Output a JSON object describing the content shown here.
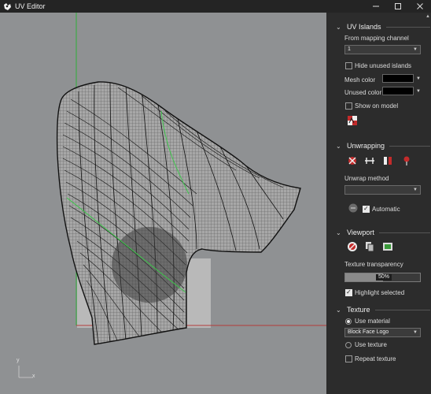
{
  "window": {
    "title": "UV Editor"
  },
  "titlebar": {
    "icons": [
      "app-logo-icon",
      "minimize-icon",
      "maximize-icon",
      "close-icon"
    ]
  },
  "viewport": {
    "axis_y_label": "y",
    "axis_x_label": "x",
    "colors": {
      "background": "#8f9193",
      "x_axis": "#b33a3a",
      "y_axis": "#2fae3a",
      "mesh": "#111111",
      "seam": "#3cc84a"
    }
  },
  "panel": {
    "uv_islands": {
      "header": "UV Islands",
      "from_mapping_channel_label": "From mapping channel",
      "channel_value": "1",
      "hide_unused_label": "Hide unused islands",
      "mesh_color_label": "Mesh color",
      "unused_color_label": "Unused color",
      "show_on_model_label": "Show on model"
    },
    "unwrapping": {
      "header": "Unwrapping",
      "unwrap_method_label": "Unwrap method",
      "unwrap_method_value": "",
      "automatic_label": "Automatic"
    },
    "viewport_section": {
      "header": "Viewport",
      "texture_transparency_label": "Texture transparency",
      "transparency_value": "50%",
      "transparency_fraction": 0.5,
      "highlight_selected_label": "Highlight selected"
    },
    "texture": {
      "header": "Texture",
      "use_material_label": "Use material",
      "material_value": "Block Face Logo",
      "use_texture_label": "Use texture",
      "repeat_texture_label": "Repeat texture"
    }
  }
}
